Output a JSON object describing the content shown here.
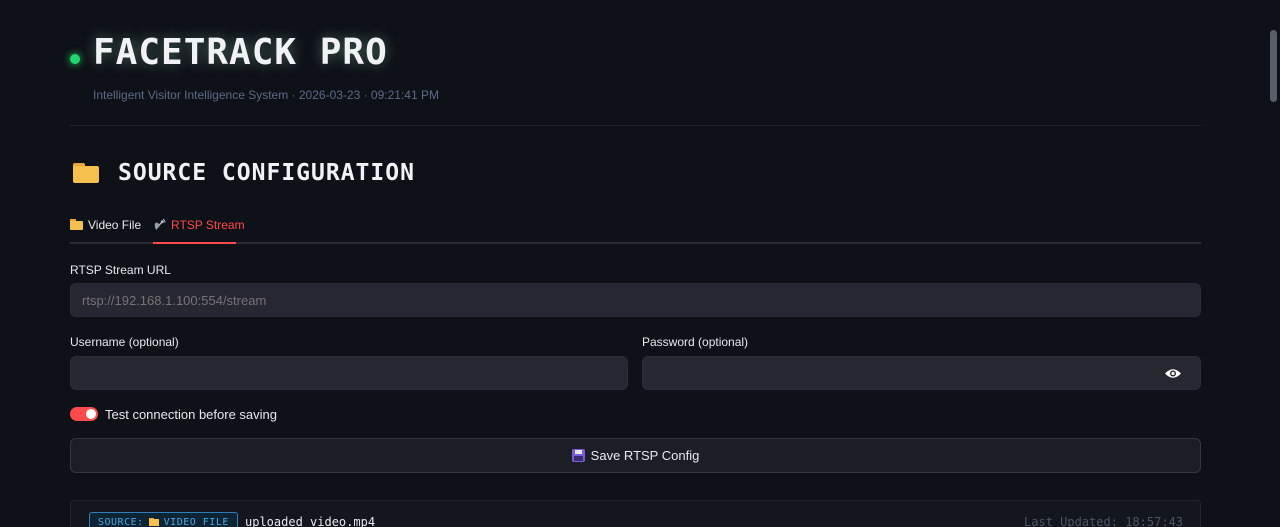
{
  "header": {
    "title": "FACETRACK PRO",
    "subtitle": "Intelligent Visitor Intelligence System · 2026-03-23 · 09:21:41 PM",
    "live_color": "#22d66f"
  },
  "section": {
    "title": "SOURCE CONFIGURATION",
    "icon": "folder-icon"
  },
  "tabs": [
    {
      "label": "Video File",
      "icon": "folder-icon",
      "active": false
    },
    {
      "label": "RTSP Stream",
      "icon": "satellite-icon",
      "active": true
    }
  ],
  "form": {
    "rtsp_label": "RTSP Stream URL",
    "rtsp_placeholder": "rtsp://192.168.1.100:554/stream",
    "rtsp_value": "",
    "username_label": "Username (optional)",
    "username_value": "",
    "password_label": "Password (optional)",
    "password_value": "",
    "password_icon": "eye-icon",
    "test_toggle_label": "Test connection before saving",
    "test_toggle_on": true,
    "save_label": "Save RTSP Config",
    "save_icon": "floppy-disk-icon"
  },
  "status": {
    "source_badge_prefix": "SOURCE:",
    "source_badge_type": "VIDEO FILE",
    "source_file": "uploaded_video.mp4",
    "last_updated": "Last Updated: 18:57:43"
  },
  "colors": {
    "accent": "#ff4b4b",
    "background": "#0e1117",
    "badge": "#4aa8e0"
  }
}
